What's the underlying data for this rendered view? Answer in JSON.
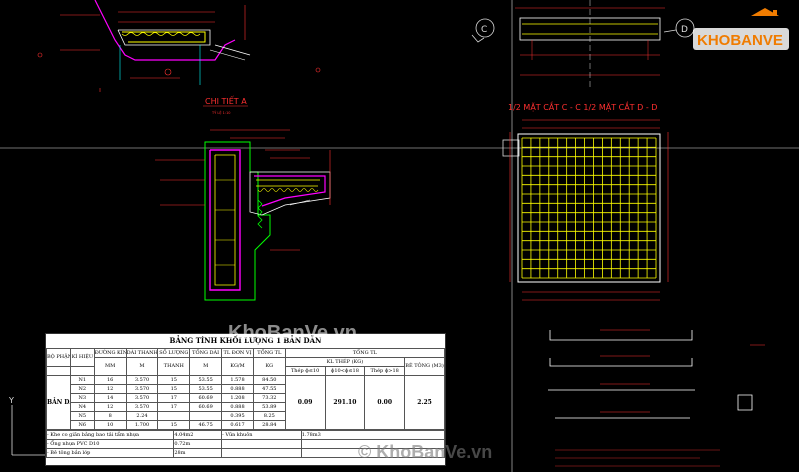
{
  "drawing": {
    "detail_title": "CHI TIẾT A",
    "detail_scale": "TỶ LỆ 1:10",
    "section_label": "1/2 MẶT CẮT C - C   1/2 MẶT CẮT D - D",
    "marker_c": "C",
    "marker_d": "D",
    "axis_y_label": "Y"
  },
  "table": {
    "title": "BẢNG TÍNH KHỐI LƯỢNG 1 BẢN DẪN",
    "headers": {
      "bo_phan": "BỘ PHẬN",
      "ky_hieu": "KÍ HIỆU",
      "duong_kinh": "ĐƯỜNG KÍNH",
      "dai_thanh": "DÀI THANH",
      "so_luong": "SỐ LƯỢNG",
      "tong_dai": "TỔNG DÀI",
      "tl_don_vi": "TL ĐƠN VỊ",
      "tong_tl": "TỔNG TL",
      "tong_tl_group": "TỔNG TL",
      "kl_thep": "KL THÉP (KG)",
      "be_tong": "BÊ TÔNG (M3)"
    },
    "units": {
      "duong_kinh": "MM",
      "dai_thanh": "M",
      "so_luong": "THANH",
      "tong_dai": "M",
      "tl_don_vi": "KG/M",
      "tong_tl": "KG",
      "thep_a": "Thép ɸ≤10",
      "thep_b": "ɸ10<ɸ≤18",
      "thep_c": "Thép ɸ>18"
    },
    "bo_phan": "BẢN DẪN",
    "rows": [
      {
        "kh": "N1",
        "dk": "16",
        "dai": "3.570",
        "sl": "15",
        "tong": "53.55",
        "tldv": "1.578",
        "tl": "84.50"
      },
      {
        "kh": "N2",
        "dk": "12",
        "dai": "3.570",
        "sl": "15",
        "tong": "53.55",
        "tldv": "0.888",
        "tl": "47.55"
      },
      {
        "kh": "N3",
        "dk": "14",
        "dai": "3.570",
        "sl": "17",
        "tong": "60.69",
        "tldv": "1.208",
        "tl": "73.32"
      },
      {
        "kh": "N4",
        "dk": "12",
        "dai": "3.570",
        "sl": "17",
        "tong": "60.69",
        "tldv": "0.888",
        "tl": "53.89"
      },
      {
        "kh": "N5",
        "dk": "8",
        "dai": "2.24",
        "sl": "",
        "tong": "",
        "tldv": "0.395",
        "tl": "8.25"
      },
      {
        "kh": "N6",
        "dk": "10",
        "dai": "1.700",
        "sl": "15",
        "tong": "46.75",
        "tldv": "0.617",
        "tl": "28.84"
      }
    ],
    "totals": {
      "a": "0.09",
      "b": "291.10",
      "c": "0.00",
      "be_tong": "2.25"
    },
    "footer": [
      {
        "label": "- Khe co giãn bằng bao tải tẩm nhựa",
        "value": "4.04m2",
        "extra_label": "- Vữa khuôn",
        "extra_value": "1.78m3"
      },
      {
        "label": "- Ống nhựa PVC D10",
        "value": "0.72m",
        "extra_label": "",
        "extra_value": ""
      },
      {
        "label": "- Bê tông bắn lớp",
        "value": "28m",
        "extra_label": "",
        "extra_value": ""
      }
    ]
  },
  "watermarks": {
    "logo_text": "KHOBANVE",
    "center": "KhoBanVe.vn",
    "bottom": "© KhoBanVe.vn"
  },
  "colors": {
    "background": "#000000",
    "steel": "#ffff00",
    "concrete": "#ff00ff",
    "outline": "#ffffff",
    "dimension": "#ff3030",
    "hatch": "#00ffff",
    "detail_outline": "#00ff00",
    "logo_orange": "#f07c00"
  }
}
